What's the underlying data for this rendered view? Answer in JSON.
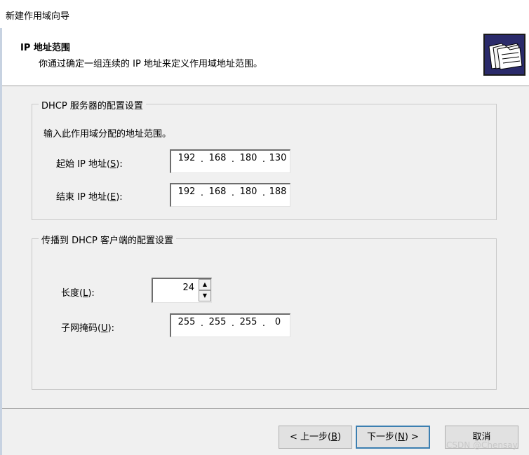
{
  "window": {
    "title": "新建作用域向导"
  },
  "header": {
    "title": "IP 地址范围",
    "subtitle": "你通过确定一组连续的 IP 地址来定义作用域地址范围。",
    "icon": "folders-wizard-icon"
  },
  "dhcp_group": {
    "legend": "DHCP 服务器的配置设置",
    "instruction": "输入此作用域分配的地址范围。",
    "start_ip": {
      "label_pre": "起始 IP 地址(",
      "label_key": "S",
      "label_post": "):",
      "octets": [
        "192",
        "168",
        "180",
        "130"
      ]
    },
    "end_ip": {
      "label_pre": "结束 IP 地址(",
      "label_key": "E",
      "label_post": "):",
      "octets": [
        "192",
        "168",
        "180",
        "188"
      ]
    }
  },
  "client_group": {
    "legend": "传播到 DHCP 客户端的配置设置",
    "length": {
      "label_pre": "长度(",
      "label_key": "L",
      "label_post": "):",
      "value": "24"
    },
    "mask": {
      "label_pre": "子网掩码(",
      "label_key": "U",
      "label_post": "):",
      "octets": [
        "255",
        "255",
        "255",
        "0"
      ]
    }
  },
  "buttons": {
    "back": {
      "pre": "< 上一步(",
      "key": "B",
      "post": ")"
    },
    "next": {
      "pre": "下一步(",
      "key": "N",
      "post": ") >"
    },
    "cancel": {
      "label": "取消"
    }
  },
  "watermark": "CSDN @Chensay."
}
